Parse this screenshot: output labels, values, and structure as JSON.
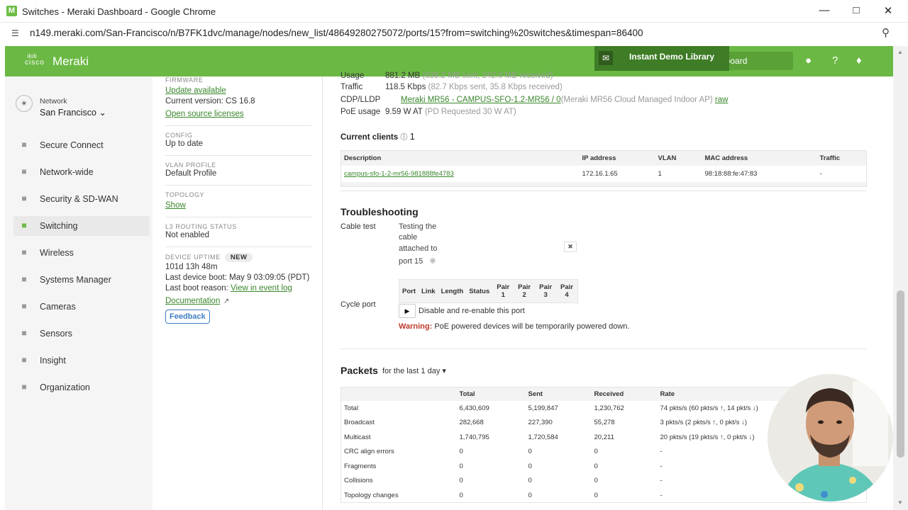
{
  "browser": {
    "app_icon_letter": "M",
    "window_title": "Switches - Meraki Dashboard - Google Chrome",
    "url": "n149.meraki.com/San-Francisco/n/B7FK1dvc/manage/nodes/new_list/48649280275072/ports/15?from=switching%20switches&timespan=86400"
  },
  "topnav": {
    "brand": "cisco",
    "product": "Meraki",
    "demo_label": "Instant Demo Library",
    "dashboard_label": "hboard"
  },
  "sidebar": {
    "network_label": "Network",
    "network_value": "San Francisco",
    "items": [
      {
        "label": "Secure Connect",
        "icon": "shield-check-icon"
      },
      {
        "label": "Network-wide",
        "icon": "network-icon"
      },
      {
        "label": "Security & SD-WAN",
        "icon": "shield-icon"
      },
      {
        "label": "Switching",
        "icon": "switch-icon",
        "active": true
      },
      {
        "label": "Wireless",
        "icon": "wifi-icon"
      },
      {
        "label": "Systems Manager",
        "icon": "laptop-icon"
      },
      {
        "label": "Cameras",
        "icon": "camera-icon"
      },
      {
        "label": "Sensors",
        "icon": "sensor-icon"
      },
      {
        "label": "Insight",
        "icon": "bar-chart-icon"
      },
      {
        "label": "Organization",
        "icon": "building-icon"
      }
    ]
  },
  "details": {
    "firmware_label": "FIRMWARE",
    "firmware_link": "Update available",
    "current_version": "Current version: CS 16.8",
    "open_source": "Open source licenses",
    "config_label": "CONFIG",
    "config_value": "Up to date",
    "vlan_label": "VLAN PROFILE",
    "vlan_value": "Default Profile",
    "topology_label": "TOPOLOGY",
    "topology_link": "Show",
    "l3_label": "L3 ROUTING STATUS",
    "l3_value": "Not enabled",
    "uptime_label": "DEVICE UPTIME",
    "new_badge": "NEW",
    "uptime_value": "101d 13h 48m",
    "last_boot": "Last device boot: May 9 03:09:05 (PDT)",
    "last_boot_reason": "Last boot reason:",
    "event_log_link": "View in event log",
    "documentation_link": "Documentation",
    "feedback": "Feedback"
  },
  "port": {
    "usage_label": "Usage",
    "usage_value": "881.2 MB",
    "usage_detail": "(639.2 MB sent, 242.0 MB received)",
    "traffic_label": "Traffic",
    "traffic_value": "118.5 Kbps",
    "traffic_detail": "(82.7 Kbps sent, 35.8 Kbps received)",
    "cdp_label": "CDP/LLDP",
    "cdp_link": "Meraki MR56 - CAMPUS-SFO-1.2-MR56 / 0",
    "cdp_detail": "(Meraki MR56 Cloud Managed Indoor AP)",
    "raw_link": "raw",
    "poe_label": "PoE usage",
    "poe_value": "9.59 W AT",
    "poe_detail": "(PD Requested 30 W AT)"
  },
  "clients": {
    "title": "Current clients",
    "count": "1",
    "headers": [
      "Description",
      "IP address",
      "VLAN",
      "MAC address",
      "Traffic"
    ],
    "rows": [
      [
        "campus-sfo-1-2-mr56-981888fe4783",
        "172.16.1.65",
        "1",
        "98:18:88:fe:47:83",
        "-"
      ]
    ]
  },
  "troubleshooting": {
    "title": "Troubleshooting",
    "cable_test_label": "Cable test",
    "testing_text": [
      "Testing the",
      "cable",
      "attached to",
      "port 15"
    ],
    "cable_headers": [
      "Port",
      "Link",
      "Length",
      "Status",
      "Pair 1",
      "Pair 2",
      "Pair 3",
      "Pair 4"
    ],
    "cycle_port_label": "Cycle port",
    "cycle_text": "Disable and re-enable this port",
    "warning_label": "Warning:",
    "warning_text": "PoE powered devices will be temporarily powered down."
  },
  "packets": {
    "title": "Packets",
    "range": "for the last 1 day",
    "headers": [
      "",
      "Total",
      "Sent",
      "Received",
      "Rate"
    ],
    "rows": [
      [
        "Total",
        "6,430,609",
        "5,199,847",
        "1,230,762",
        "74 pkts/s (60 pkts/s ↑, 14 pkt/s ↓)"
      ],
      [
        "Broadcast",
        "282,668",
        "227,390",
        "55,278",
        "3 pkts/s (2 pkts/s ↑, 0 pkt/s ↓)"
      ],
      [
        "Multicast",
        "1,740,795",
        "1,720,584",
        "20,211",
        "20 pkts/s (19 pkts/s ↑, 0 pkt/s ↓)"
      ],
      [
        "CRC align errors",
        "0",
        "0",
        "0",
        "-"
      ],
      [
        "Fragments",
        "0",
        "0",
        "0",
        "-"
      ],
      [
        "Collisions",
        "0",
        "0",
        "0",
        "-"
      ],
      [
        "Topology changes",
        "0",
        "0",
        "0",
        "-"
      ]
    ]
  },
  "colors": {
    "brand_green": "#6bb944",
    "link_green": "#39862b",
    "warning_red": "#c0392b"
  }
}
